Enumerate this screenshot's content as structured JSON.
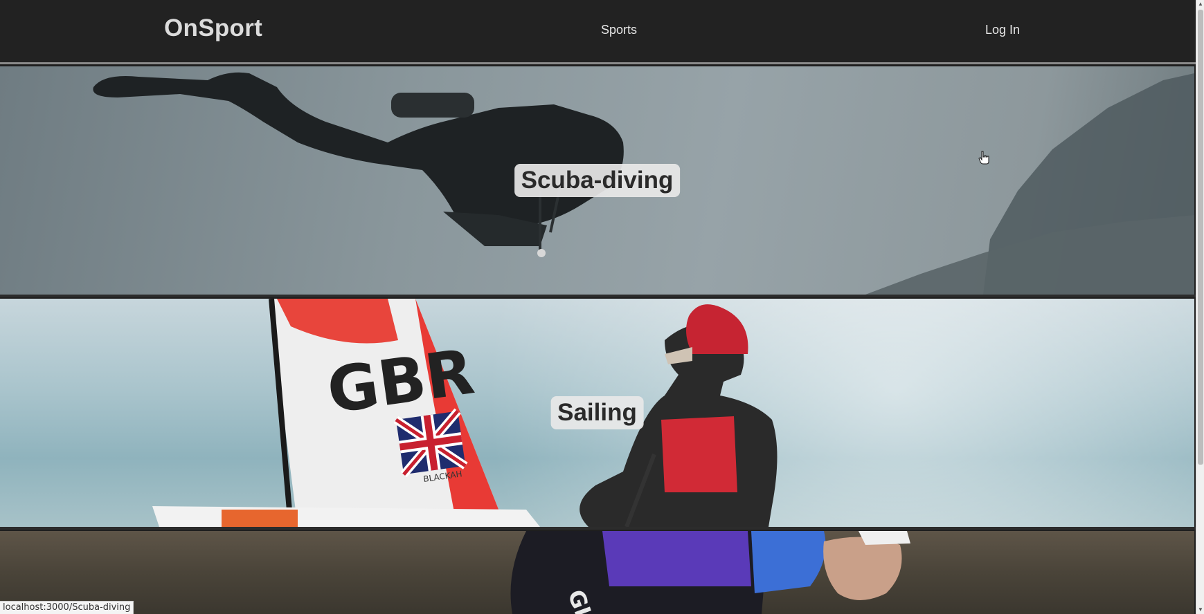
{
  "navbar": {
    "brand": "OnSport",
    "links": [
      {
        "label": "Sports"
      },
      {
        "label": "Log In"
      }
    ]
  },
  "sports": [
    {
      "label": "Scuba-diving"
    },
    {
      "label": "Sailing"
    },
    {
      "label": ""
    }
  ],
  "sailing_scene": {
    "sail_text": "GBR",
    "sail_name": "BLACKAH"
  },
  "status_bar": {
    "url": "localhost:3000/Scuba-diving"
  },
  "colors": {
    "navbar_bg": "#222222",
    "nav_text": "#e6e6e6",
    "label_bg": "#e8e8e8",
    "label_text": "#2a2a2a"
  },
  "icons": {
    "cursor": "hand-pointer-icon",
    "scroll_up": "triangle-up-icon",
    "scroll_down": "triangle-down-icon"
  }
}
